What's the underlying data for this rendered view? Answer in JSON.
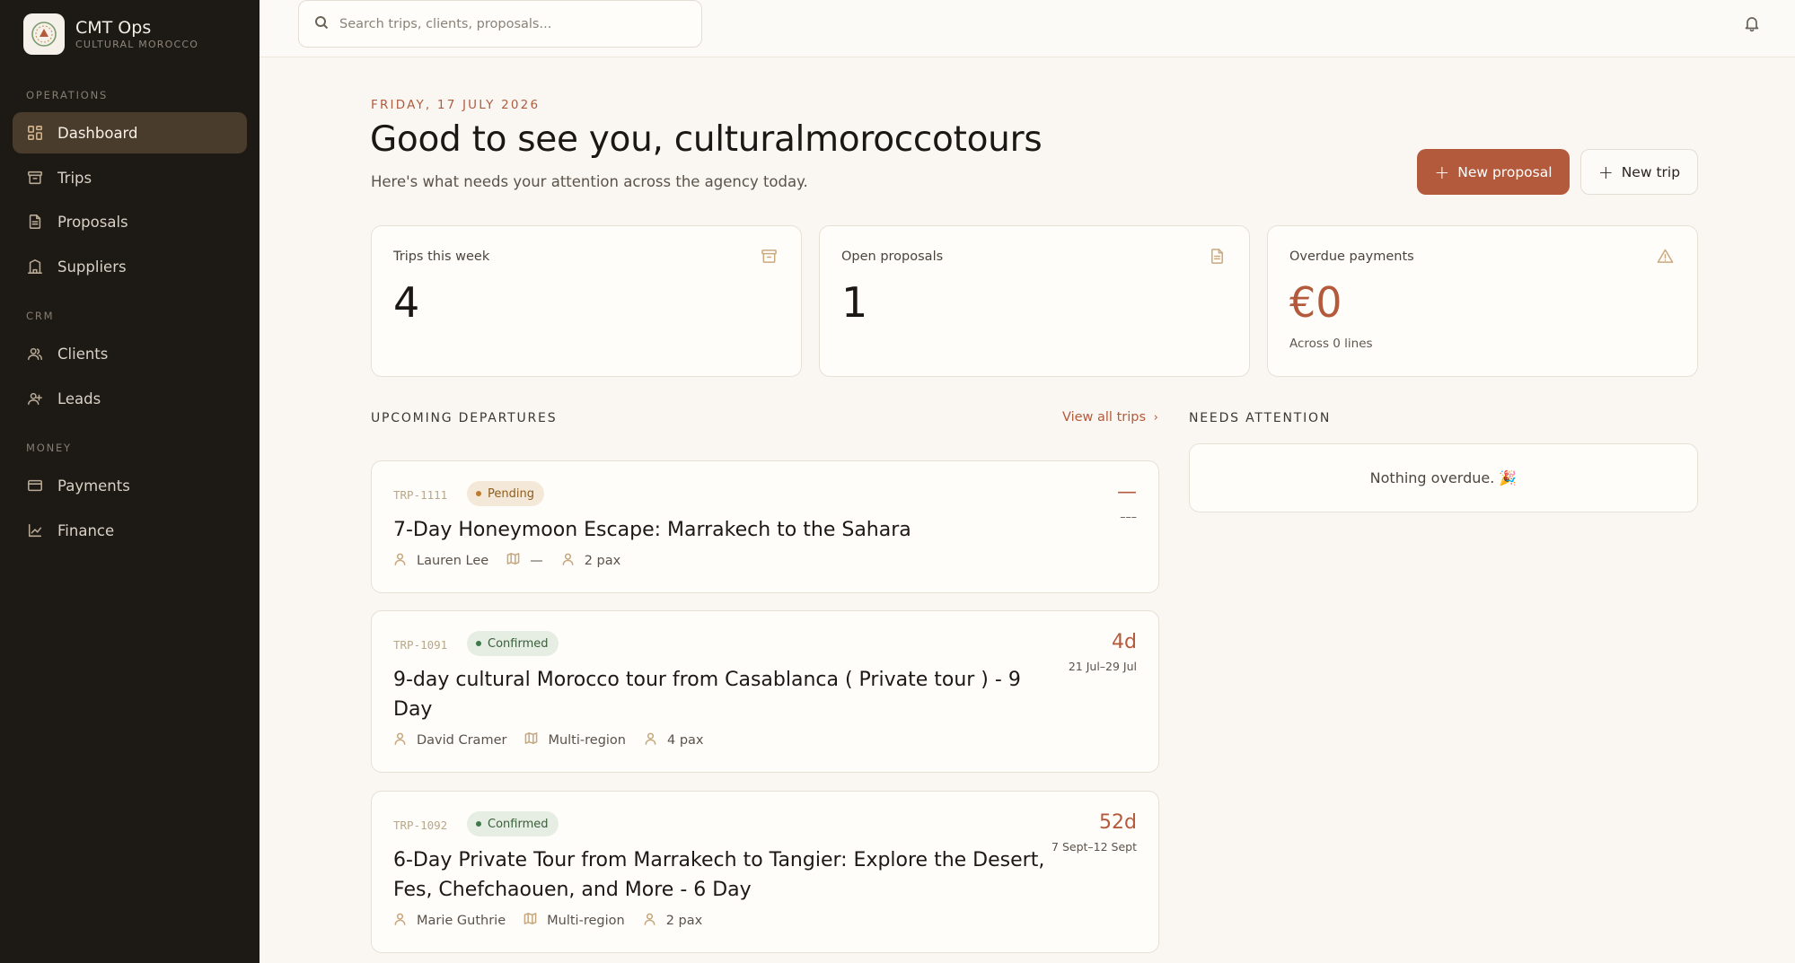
{
  "brand": {
    "name": "CMT Ops",
    "subtitle": "CULTURAL MOROCCO"
  },
  "sidebar": {
    "sections": [
      {
        "title": "OPERATIONS"
      },
      {
        "title": "CRM"
      },
      {
        "title": "MONEY"
      }
    ],
    "items": [
      {
        "label": "Dashboard",
        "icon": "dashboard-icon",
        "active": true
      },
      {
        "label": "Trips",
        "icon": "archive-icon"
      },
      {
        "label": "Proposals",
        "icon": "document-icon"
      },
      {
        "label": "Suppliers",
        "icon": "building-icon"
      },
      {
        "label": "Clients",
        "icon": "users-icon"
      },
      {
        "label": "Leads",
        "icon": "user-plus-icon"
      },
      {
        "label": "Payments",
        "icon": "card-icon"
      },
      {
        "label": "Finance",
        "icon": "line-chart-icon"
      }
    ]
  },
  "search": {
    "placeholder": "Search trips, clients, proposals..."
  },
  "header": {
    "date": "FRIDAY, 17 JULY 2026",
    "greeting": "Good to see you, culturalmoroccotours",
    "subtitle": "Here's what needs your attention across the agency today.",
    "new_proposal": "New proposal",
    "new_trip": "New trip"
  },
  "stats": [
    {
      "label": "Trips this week",
      "value": "4",
      "icon": "archive-icon"
    },
    {
      "label": "Open proposals",
      "value": "1",
      "icon": "document-icon"
    },
    {
      "label": "Overdue payments",
      "value": "€0",
      "note": "Across 0 lines",
      "icon": "warning-icon"
    }
  ],
  "departures": {
    "title": "UPCOMING DEPARTURES",
    "view_all": "View all trips",
    "trips": [
      {
        "id": "TRP-1111",
        "status": "Pending",
        "title": "7-Day Honeymoon Escape: Marrakech to the Sahara",
        "client": "Lauren Lee",
        "region": "—",
        "pax": "2 pax",
        "countdown": "—",
        "range": "–––"
      },
      {
        "id": "TRP-1091",
        "status": "Confirmed",
        "title": "9-day cultural Morocco tour from Casablanca ( Private tour ) - 9 Day",
        "client": "David Cramer",
        "region": "Multi-region",
        "pax": "4 pax",
        "countdown": "4d",
        "range": "21 Jul–29 Jul"
      },
      {
        "id": "TRP-1092",
        "status": "Confirmed",
        "title": "6-Day Private Tour from Marrakech to Tangier: Explore the Desert, Fes, Chefchaouen, and More - 6 Day",
        "client": "Marie Guthrie",
        "region": "Multi-region",
        "pax": "2 pax",
        "countdown": "52d",
        "range": "7 Sept–12 Sept"
      }
    ]
  },
  "attention": {
    "title": "NEEDS ATTENTION",
    "empty": "Nothing overdue. 🎉"
  },
  "colors": {
    "accent": "#b35a3c",
    "sidebar": "#1d1915",
    "active_nav": "#4a3c2d",
    "background": "#faf7f2"
  }
}
